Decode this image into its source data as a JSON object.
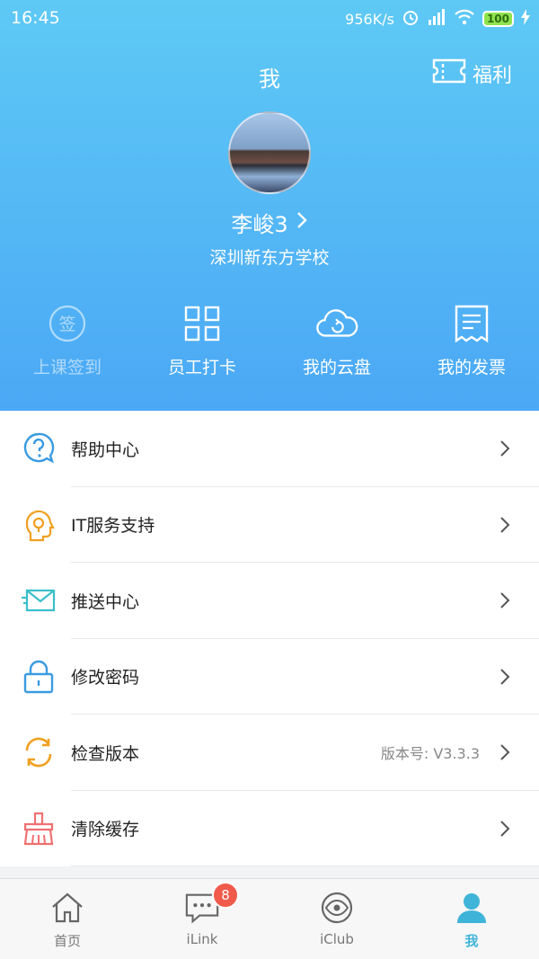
{
  "status_bar": {
    "time": "16:45",
    "speed": "956K/s",
    "battery": "100"
  },
  "header": {
    "title": "我",
    "welfare_label": "福利"
  },
  "profile": {
    "name": "李峻3",
    "school": "深圳新东方学校"
  },
  "quick_actions": [
    {
      "label": "上课签到",
      "icon": "sign-in-icon"
    },
    {
      "label": "员工打卡",
      "icon": "qr-code-icon"
    },
    {
      "label": "我的云盘",
      "icon": "cloud-icon"
    },
    {
      "label": "我的发票",
      "icon": "invoice-icon"
    }
  ],
  "menu": [
    {
      "label": "帮助中心",
      "icon": "help-icon",
      "color": "#3a9be0"
    },
    {
      "label": "IT服务支持",
      "icon": "it-support-icon",
      "color": "#f0a020"
    },
    {
      "label": "推送中心",
      "icon": "push-icon",
      "color": "#3abfc9"
    },
    {
      "label": "修改密码",
      "icon": "lock-icon",
      "color": "#3a9be0"
    },
    {
      "label": "检查版本",
      "icon": "refresh-icon",
      "color": "#f0a020",
      "meta": "版本号: V3.3.3"
    },
    {
      "label": "清除缓存",
      "icon": "broom-icon",
      "color": "#f07070"
    }
  ],
  "tabs": [
    {
      "label": "首页",
      "icon": "home-icon"
    },
    {
      "label": "iLink",
      "icon": "chat-icon",
      "badge": "8"
    },
    {
      "label": "iClub",
      "icon": "eye-icon"
    },
    {
      "label": "我",
      "icon": "profile-icon",
      "active": true
    }
  ],
  "colors": {
    "accent": "#3fb4d8",
    "header_top": "#5ec9f5",
    "header_bottom": "#4ba8f5",
    "badge": "#f05a4a"
  }
}
